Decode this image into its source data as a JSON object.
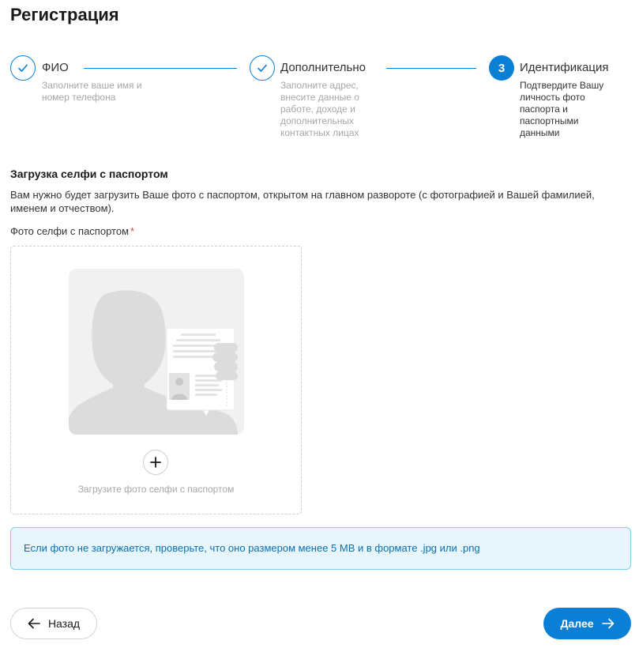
{
  "page": {
    "title": "Регистрация"
  },
  "stepper": {
    "steps": [
      {
        "title": "ФИО",
        "description": "Заполните ваше имя и номер телефона",
        "state": "done"
      },
      {
        "title": "Дополнительно",
        "description": "Заполните адрес, внесите данные о работе, доходе и дополнительных контактных лицах",
        "state": "done"
      },
      {
        "number": "3",
        "title": "Идентификация",
        "description": "Подтвердите Вашу личность фото паспорта и паспортными данными",
        "state": "active"
      }
    ]
  },
  "section": {
    "title": "Загрузка селфи с паспортом",
    "description": "Вам нужно будет загрузить Ваше фото с паспортом, открытом на главном развороте (с фотографией и Вашей фамилией, именем и отчеством)."
  },
  "upload": {
    "label": "Фото селфи с паспортом",
    "required_mark": "*",
    "hint": "Загрузите фото селфи с паспортом"
  },
  "info": {
    "text": "Если фото не загружается, проверьте, что оно размером менее 5 MB и в формате .jpg или .png"
  },
  "actions": {
    "back_label": "Назад",
    "next_label": "Далее"
  },
  "colors": {
    "accent": "#0a7fd6",
    "info_bg": "#e6f6fc",
    "info_border": "#7fd1ea",
    "required": "#e53935"
  }
}
